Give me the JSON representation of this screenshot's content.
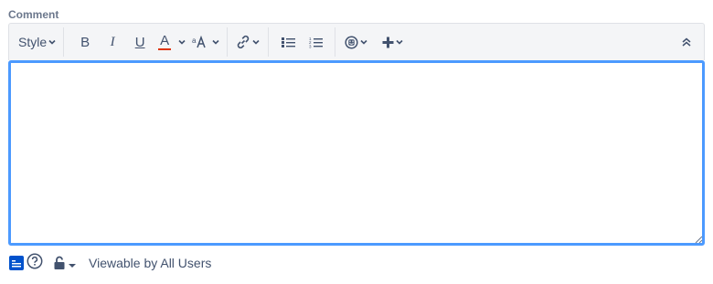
{
  "field": {
    "label": "Comment"
  },
  "toolbar": {
    "style_label": "Style",
    "bold_label": "B",
    "italic_label": "I",
    "underline_label": "U",
    "text_color_label": "A",
    "text_color_underline": "#de350b"
  },
  "editor": {
    "value": ""
  },
  "footer": {
    "visibility_label": "Viewable by All Users"
  },
  "colors": {
    "focus_border": "#4c9aff",
    "toolbar_bg": "#f4f5f7",
    "icon": "#42526e",
    "footer_icon": "#0052cc"
  }
}
